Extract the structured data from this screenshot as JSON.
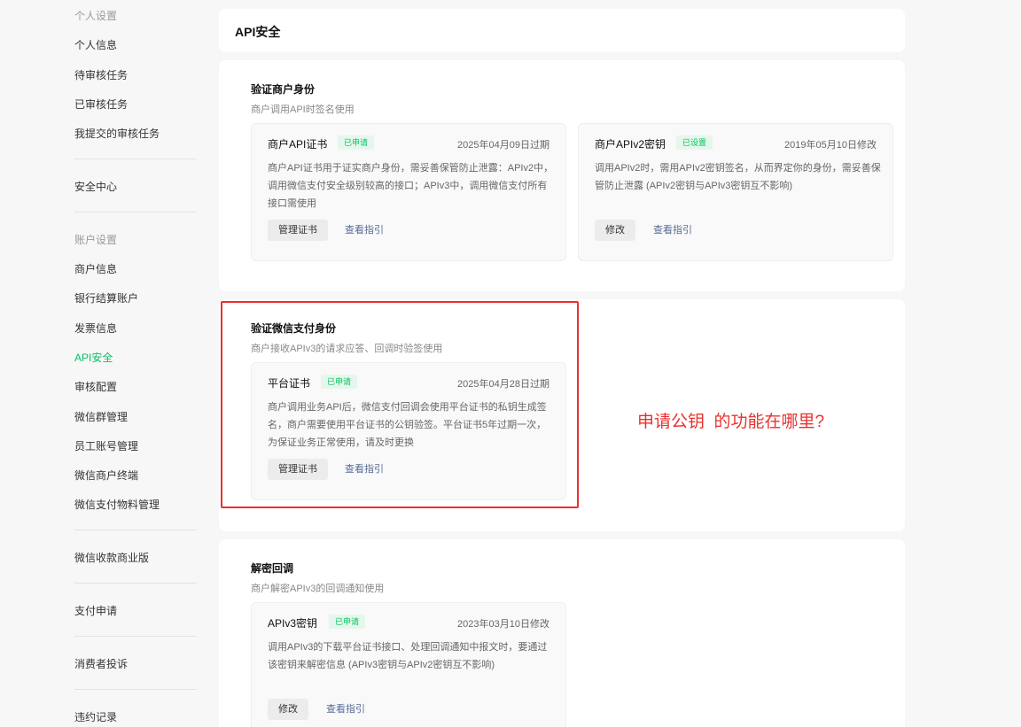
{
  "sidebar": {
    "group_personal": "个人设置",
    "personal_items": [
      "个人信息",
      "待审核任务",
      "已审核任务",
      "我提交的审核任务"
    ],
    "security_center": "安全中心",
    "group_account": "账户设置",
    "account_items": [
      "商户信息",
      "银行结算账户",
      "发票信息",
      "API安全",
      "审核配置",
      "微信群管理",
      "员工账号管理",
      "微信商户终端",
      "微信支付物料管理"
    ],
    "wechat_pay_business": "微信收款商业版",
    "payment_application": "支付申请",
    "consumer_complaint": "消费者投诉",
    "violation_record": "违约记录"
  },
  "page": {
    "title": "API安全"
  },
  "verify_merchant": {
    "title": "验证商户身份",
    "subtitle": "商户调用API时签名使用",
    "cards": [
      {
        "title": "商户API证书",
        "badge": "已申请",
        "date": "2025年04月09日过期",
        "desc": "商户API证书用于证实商户身份，需妥善保管防止泄露：APIv2中，调用微信支付安全级别较高的接口；APIv3中，调用微信支付所有接口需使用",
        "button": "管理证书",
        "link": "查看指引"
      },
      {
        "title": "商户APIv2密钥",
        "badge": "已设置",
        "date": "2019年05月10日修改",
        "desc": "调用APIv2时，需用APIv2密钥签名，从而界定你的身份，需妥善保管防止泄露 (APIv2密钥与APIv3密钥互不影响)",
        "button": "修改",
        "link": "查看指引"
      }
    ]
  },
  "verify_wechat": {
    "title": "验证微信支付身份",
    "subtitle": "商户接收APIv3的请求应答、回调时验签使用",
    "card": {
      "title": "平台证书",
      "badge": "已申请",
      "date": "2025年04月28日过期",
      "desc": "商户调用业务API后，微信支付回调会使用平台证书的私钥生成签名，商户需要使用平台证书的公钥验签。平台证书5年过期一次，为保证业务正常使用，请及时更换",
      "button": "管理证书",
      "link": "查看指引"
    }
  },
  "decrypt_callback": {
    "title": "解密回调",
    "subtitle": "商户解密APIv3的回调通知使用",
    "card": {
      "title": "APIv3密钥",
      "badge": "已申请",
      "date": "2023年03月10日修改",
      "desc": "调用APIv3的下载平台证书接口、处理回调通知中报文时，要通过该密钥来解密信息 (APIv3密钥与APIv2密钥互不影响)",
      "button": "修改",
      "link": "查看指引"
    }
  },
  "annotation": {
    "text": "申请公钥  的功能在哪里?"
  },
  "colors": {
    "accent": "#07c160",
    "link": "#576b95",
    "highlight": "#e8312f"
  }
}
